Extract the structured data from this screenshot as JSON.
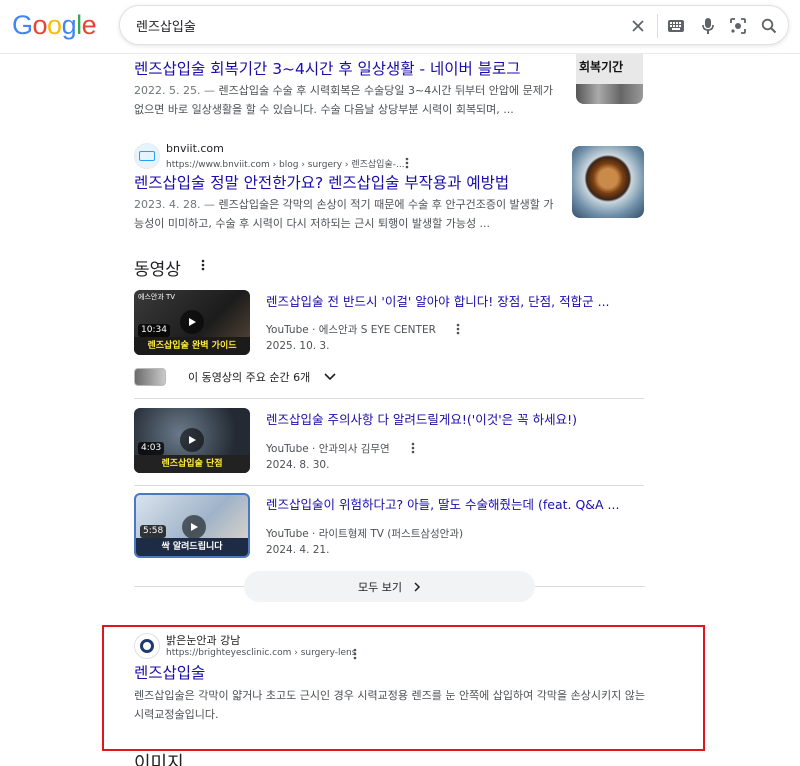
{
  "header": {
    "logo": "Google",
    "search": {
      "value": "렌즈삽입술"
    },
    "icons": [
      "close-icon",
      "keyboard-icon",
      "mic-icon",
      "lens-icon",
      "search-icon"
    ]
  },
  "results_top": [
    {
      "title": "렌즈삽입술 회복기간 3~4시간 후 일상생활 - 네이버 블로그",
      "date": "2022. 5. 25. — ",
      "snippet": "렌즈삽입술 수술 후 시력회복은 수술당일 3~4시간 뒤부터 안압에 문제가 없으면 바로 일상생활을 할 수 있습니다. 수술 다음날 상당부분 시력이 회복되며, ...",
      "thumb_text": "회복기간"
    },
    {
      "site_name": "bnviit.com",
      "url": "https://www.bnviit.com › blog › surgery › 렌즈삽입술-...",
      "title": "렌즈삽입술 정말 안전한가요? 렌즈삽입술 부작용과 예방법",
      "date": "2023. 4. 28. — ",
      "snippet": "렌즈삽입술은 각막의 손상이 적기 때문에 수술 후 안구건조증이 발생할 가능성이 미미하고, 수술 후 시력이 다시 저하되는 근시 퇴행이 발생할 가능성 ..."
    }
  ],
  "videos": {
    "heading": "동영상",
    "items": [
      {
        "title": "렌즈삽입술 전 반드시 '이걸' 알아야 합니다! 장점, 단점, 적합군 ...",
        "source": "YouTube · 에스안과 S EYE CENTER",
        "date": "2025. 10. 3.",
        "duration": "10:34",
        "caption": "렌즈삽입술 완벽 가이드"
      },
      {
        "title": "렌즈삽입술 주의사항 다 알려드릴게요!('이것'은 꼭 하세요!)",
        "source": "YouTube · 안과의사 김무연",
        "date": "2024. 8. 30.",
        "duration": "4:03",
        "caption": "렌즈삽입술 단점"
      },
      {
        "title": "렌즈삽입술이 위험하다고? 아들, 딸도 수술해줬는데 (feat. Q&A ...",
        "source": "YouTube · 라이트형제 TV (퍼스트삼성안과)",
        "date": "2024. 4. 21.",
        "duration": "5:58",
        "caption": "싹 알려드립니다"
      }
    ],
    "key_moments": "이 동영상의 주요 순간 6개",
    "see_all": "모두 보기"
  },
  "result_bottom": {
    "site_name": "밝은눈안과 강남",
    "url": "https://brighteyesclinic.com › surgery-lens",
    "title": "렌즈삽입술",
    "snippet": "렌즈삽입술은 각막이 얇거나 초고도 근시인 경우 시력교정용 렌즈를 눈 안쪽에 삽입하여 각막을 손상시키지 않는 시력교정술입니다."
  },
  "next_section": "이미지",
  "colors": {
    "link": "#1a0dab",
    "highlight": "#e0151d"
  }
}
